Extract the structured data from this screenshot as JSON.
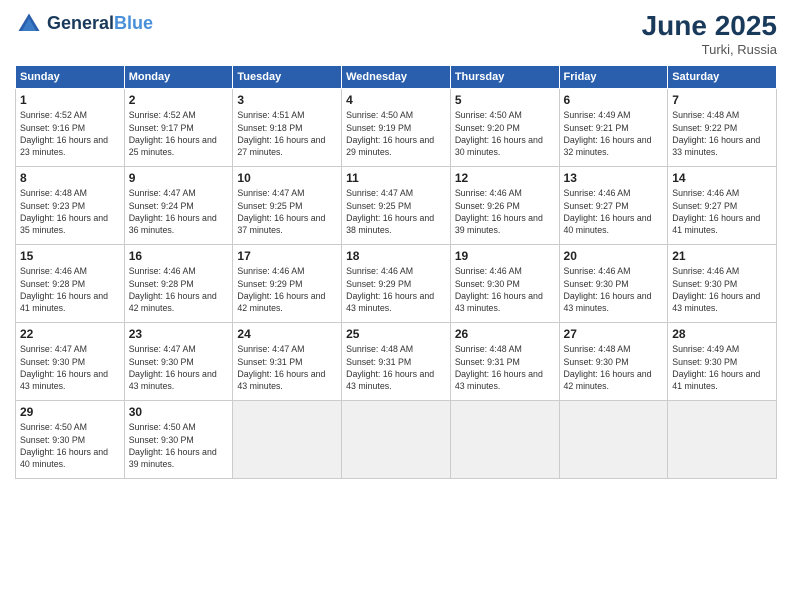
{
  "header": {
    "logo_line1": "General",
    "logo_line2": "Blue",
    "month_title": "June 2025",
    "location": "Turki, Russia"
  },
  "weekdays": [
    "Sunday",
    "Monday",
    "Tuesday",
    "Wednesday",
    "Thursday",
    "Friday",
    "Saturday"
  ],
  "days": [
    {
      "num": "1",
      "sunrise": "4:52 AM",
      "sunset": "9:16 PM",
      "daylight": "16 hours and 23 minutes."
    },
    {
      "num": "2",
      "sunrise": "4:52 AM",
      "sunset": "9:17 PM",
      "daylight": "16 hours and 25 minutes."
    },
    {
      "num": "3",
      "sunrise": "4:51 AM",
      "sunset": "9:18 PM",
      "daylight": "16 hours and 27 minutes."
    },
    {
      "num": "4",
      "sunrise": "4:50 AM",
      "sunset": "9:19 PM",
      "daylight": "16 hours and 29 minutes."
    },
    {
      "num": "5",
      "sunrise": "4:50 AM",
      "sunset": "9:20 PM",
      "daylight": "16 hours and 30 minutes."
    },
    {
      "num": "6",
      "sunrise": "4:49 AM",
      "sunset": "9:21 PM",
      "daylight": "16 hours and 32 minutes."
    },
    {
      "num": "7",
      "sunrise": "4:48 AM",
      "sunset": "9:22 PM",
      "daylight": "16 hours and 33 minutes."
    },
    {
      "num": "8",
      "sunrise": "4:48 AM",
      "sunset": "9:23 PM",
      "daylight": "16 hours and 35 minutes."
    },
    {
      "num": "9",
      "sunrise": "4:47 AM",
      "sunset": "9:24 PM",
      "daylight": "16 hours and 36 minutes."
    },
    {
      "num": "10",
      "sunrise": "4:47 AM",
      "sunset": "9:25 PM",
      "daylight": "16 hours and 37 minutes."
    },
    {
      "num": "11",
      "sunrise": "4:47 AM",
      "sunset": "9:25 PM",
      "daylight": "16 hours and 38 minutes."
    },
    {
      "num": "12",
      "sunrise": "4:46 AM",
      "sunset": "9:26 PM",
      "daylight": "16 hours and 39 minutes."
    },
    {
      "num": "13",
      "sunrise": "4:46 AM",
      "sunset": "9:27 PM",
      "daylight": "16 hours and 40 minutes."
    },
    {
      "num": "14",
      "sunrise": "4:46 AM",
      "sunset": "9:27 PM",
      "daylight": "16 hours and 41 minutes."
    },
    {
      "num": "15",
      "sunrise": "4:46 AM",
      "sunset": "9:28 PM",
      "daylight": "16 hours and 41 minutes."
    },
    {
      "num": "16",
      "sunrise": "4:46 AM",
      "sunset": "9:28 PM",
      "daylight": "16 hours and 42 minutes."
    },
    {
      "num": "17",
      "sunrise": "4:46 AM",
      "sunset": "9:29 PM",
      "daylight": "16 hours and 42 minutes."
    },
    {
      "num": "18",
      "sunrise": "4:46 AM",
      "sunset": "9:29 PM",
      "daylight": "16 hours and 43 minutes."
    },
    {
      "num": "19",
      "sunrise": "4:46 AM",
      "sunset": "9:30 PM",
      "daylight": "16 hours and 43 minutes."
    },
    {
      "num": "20",
      "sunrise": "4:46 AM",
      "sunset": "9:30 PM",
      "daylight": "16 hours and 43 minutes."
    },
    {
      "num": "21",
      "sunrise": "4:46 AM",
      "sunset": "9:30 PM",
      "daylight": "16 hours and 43 minutes."
    },
    {
      "num": "22",
      "sunrise": "4:47 AM",
      "sunset": "9:30 PM",
      "daylight": "16 hours and 43 minutes."
    },
    {
      "num": "23",
      "sunrise": "4:47 AM",
      "sunset": "9:30 PM",
      "daylight": "16 hours and 43 minutes."
    },
    {
      "num": "24",
      "sunrise": "4:47 AM",
      "sunset": "9:31 PM",
      "daylight": "16 hours and 43 minutes."
    },
    {
      "num": "25",
      "sunrise": "4:48 AM",
      "sunset": "9:31 PM",
      "daylight": "16 hours and 43 minutes."
    },
    {
      "num": "26",
      "sunrise": "4:48 AM",
      "sunset": "9:31 PM",
      "daylight": "16 hours and 43 minutes."
    },
    {
      "num": "27",
      "sunrise": "4:48 AM",
      "sunset": "9:30 PM",
      "daylight": "16 hours and 42 minutes."
    },
    {
      "num": "28",
      "sunrise": "4:49 AM",
      "sunset": "9:30 PM",
      "daylight": "16 hours and 41 minutes."
    },
    {
      "num": "29",
      "sunrise": "4:50 AM",
      "sunset": "9:30 PM",
      "daylight": "16 hours and 40 minutes."
    },
    {
      "num": "30",
      "sunrise": "4:50 AM",
      "sunset": "9:30 PM",
      "daylight": "16 hours and 39 minutes."
    }
  ],
  "labels": {
    "sunrise": "Sunrise:",
    "sunset": "Sunset:",
    "daylight": "Daylight:"
  }
}
